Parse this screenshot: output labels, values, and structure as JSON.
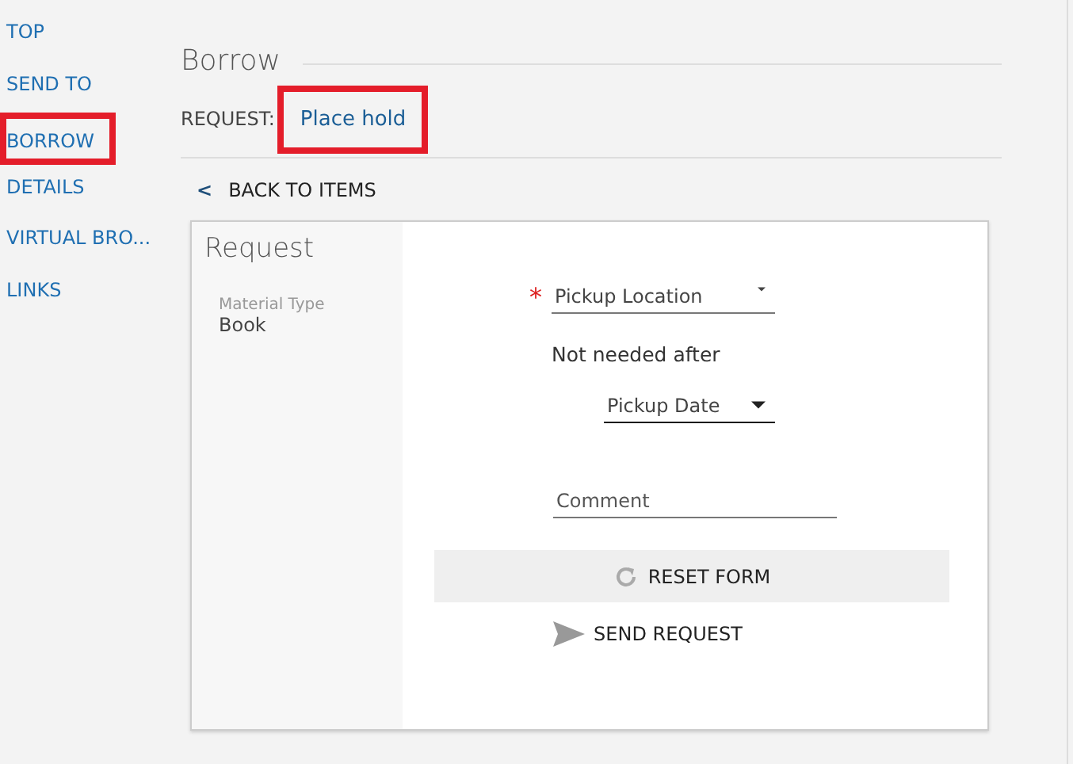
{
  "sidebar": {
    "items": [
      {
        "label": "TOP",
        "highlighted": false
      },
      {
        "label": "SEND TO",
        "highlighted": false
      },
      {
        "label": "BORROW",
        "highlighted": true
      },
      {
        "label": "DETAILS",
        "highlighted": false
      },
      {
        "label": "VIRTUAL BRO...",
        "highlighted": false
      },
      {
        "label": "LINKS",
        "highlighted": false
      }
    ]
  },
  "section": {
    "title": "Borrow",
    "request_label": "REQUEST:",
    "request_option": {
      "label": "Place hold",
      "highlighted": true
    }
  },
  "back_link": {
    "icon": "<",
    "label": "BACK TO ITEMS"
  },
  "card": {
    "title": "Request",
    "material_type_label": "Material Type",
    "material_type_value": "Book",
    "pickup_location": {
      "placeholder": "Pickup Location",
      "required_mark": "*"
    },
    "not_needed_after": "Not needed after",
    "pickup_date": {
      "placeholder": "Pickup Date"
    },
    "comment": {
      "placeholder": "Comment"
    },
    "buttons": [
      {
        "kind": "reset",
        "label": "RESET FORM"
      },
      {
        "kind": "send",
        "label": "SEND REQUEST"
      }
    ]
  }
}
